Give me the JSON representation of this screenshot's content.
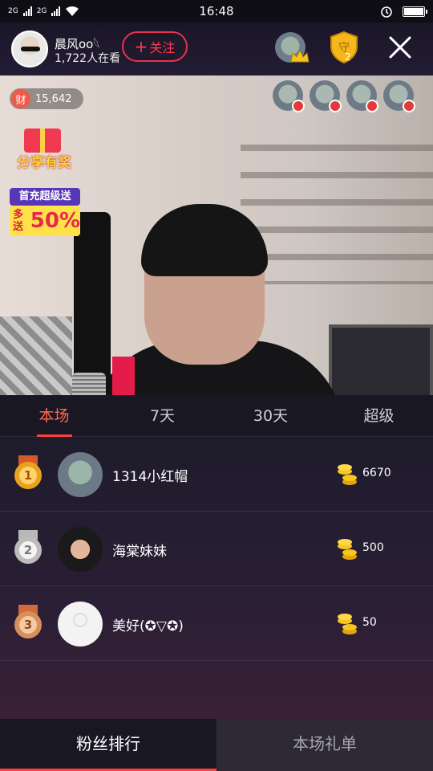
{
  "status_bar": {
    "time": "16:48",
    "sim1": "2G",
    "sim2": "2G"
  },
  "header": {
    "host_name": "晨风oo𓆩",
    "viewer_count": "1,722人在看",
    "follow_label": "关注",
    "follow_plus": "+",
    "guard_count": "2"
  },
  "live": {
    "wealth_icon_label": "财",
    "wealth_value": "15,642",
    "promo_share": "分享有奖",
    "promo_recharge_top": "首充超级送",
    "promo_recharge_prefix": "多送",
    "promo_recharge_pct": "50%"
  },
  "tabs": [
    {
      "label": "本场",
      "active": true
    },
    {
      "label": "7天",
      "active": false
    },
    {
      "label": "30天",
      "active": false
    },
    {
      "label": "超级",
      "active": false
    }
  ],
  "ranking": [
    {
      "rank": "1",
      "name": "1314小红帽",
      "coins": "6670"
    },
    {
      "rank": "2",
      "name": "海棠妹妹",
      "coins": "500"
    },
    {
      "rank": "3",
      "name": "美好(✪▽✪)",
      "coins": "50"
    }
  ],
  "bottom_tabs": [
    {
      "label": "粉丝排行",
      "active": true
    },
    {
      "label": "本场礼单",
      "active": false
    }
  ],
  "colors": {
    "accent": "#ff3f3f",
    "follow": "#e8334a",
    "active_tab": "#ff6a50"
  },
  "icons": {
    "close": "close-icon",
    "guard": "guard-shield-icon",
    "crown": "crown-icon",
    "coin": "coin-stack-icon"
  }
}
